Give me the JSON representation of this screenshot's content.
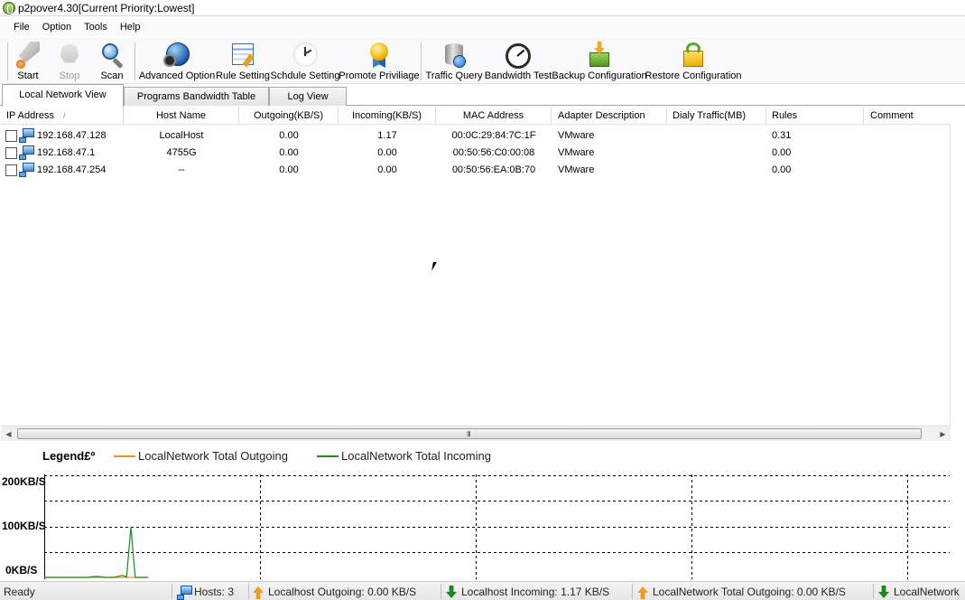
{
  "window": {
    "title": "p2pover4.30[Current Priority:Lowest]"
  },
  "menu": [
    "File",
    "Option",
    "Tools",
    "Help"
  ],
  "toolbar": {
    "start": "Start",
    "stop": "Stop",
    "scan": "Scan",
    "advanced_option": "Advanced Option",
    "rule_setting": "Rule Setting",
    "schedule_setting": "Schdule Setting",
    "promote_privilege": "Promote Priviliage",
    "traffic_query": "Traffic Query",
    "bandwidth_test": "Bandwidth Test",
    "backup_configuration": "Backup Configuration",
    "restore_configuration": "Restore Configuration"
  },
  "tabs": [
    "Local Network View",
    "Programs Bandwidth Table",
    "Log View"
  ],
  "table": {
    "columns": [
      "IP Address",
      "Host Name",
      "Outgoing(KB/S)",
      "Incoming(KB/S)",
      "MAC Address",
      "Adapter Description",
      "Dialy Traffic(MB)",
      "Rules",
      "Comment"
    ],
    "sort_mark": "/",
    "rows": [
      {
        "ip": "192.168.47.128",
        "host": "LocalHost",
        "out": "0.00",
        "in": "1.17",
        "mac": "00:0C:29:84:7C:1F",
        "adapter": "VMware",
        "daily": "",
        "rules": "0.31",
        "comment": ""
      },
      {
        "ip": "192.168.47.1",
        "host": "4755G",
        "out": "0.00",
        "in": "0.00",
        "mac": "00:50:56:C0:00:08",
        "adapter": "VMware",
        "daily": "",
        "rules": "0.00",
        "comment": ""
      },
      {
        "ip": "192.168.47.254",
        "host": "--",
        "out": "0.00",
        "in": "0.00",
        "mac": "00:50:56:EA:0B:70",
        "adapter": "VMware",
        "daily": "",
        "rules": "0.00",
        "comment": ""
      }
    ]
  },
  "scrollbar": {
    "grip": "III"
  },
  "graph": {
    "legend_title": "Legend£º",
    "series": [
      {
        "name": "LocalNetwork Total Outgoing",
        "color": "#f0901e"
      },
      {
        "name": "LocalNetwork Total Incoming",
        "color": "#1f8a1f"
      }
    ],
    "y_labels": [
      "200KB/S",
      "100KB/S",
      "0KB/S"
    ],
    "y_max_kbs": 200,
    "incoming_kbs": [
      0,
      0,
      0,
      0,
      0,
      0,
      0,
      0,
      0,
      0,
      0,
      1,
      2,
      1.5,
      0,
      0,
      0,
      2,
      4,
      1,
      98,
      0,
      0,
      0,
      0
    ],
    "outgoing_kbs": [
      0,
      0,
      0,
      0,
      0,
      0,
      0,
      0,
      0,
      0,
      0,
      0,
      0,
      0,
      0,
      0,
      0,
      0,
      0,
      0,
      0,
      0,
      0,
      0,
      0
    ]
  },
  "status": {
    "ready": "Ready",
    "hosts": "Hosts: 3",
    "localhost_out": "Localhost Outgoing: 0.00 KB/S",
    "localhost_in": "Localhost Incoming: 1.17 KB/S",
    "network_out": "LocalNetwork Total Outgoing: 0.00 KB/S",
    "network_in": "LocalNetwork"
  }
}
